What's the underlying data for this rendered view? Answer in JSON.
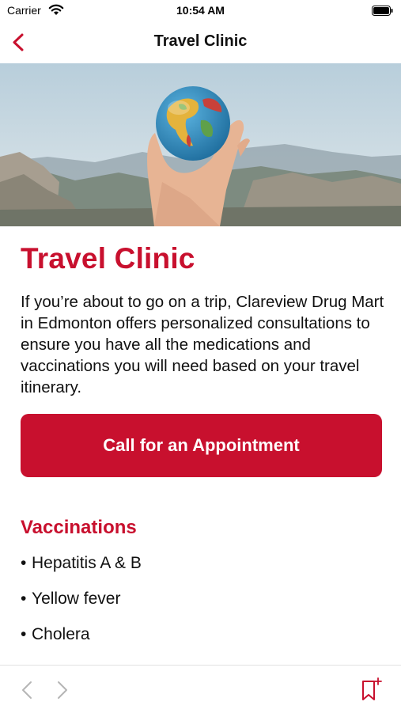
{
  "status_bar": {
    "carrier": "Carrier",
    "time": "10:54 AM"
  },
  "nav": {
    "title": "Travel Clinic",
    "back_icon": "chevron-left-icon"
  },
  "content": {
    "heading": "Travel Clinic",
    "intro": "If you’re about to go on a trip, Clareview Drug Mart in Edmonton offers personalized consultations to ensure you have all the medications and vaccinations you will need based on your travel itinerary.",
    "cta_label": "Call for an Appointment",
    "vaccinations_heading": "Vaccinations",
    "vaccinations": [
      "Hepatitis A & B",
      "Yellow fever",
      "Cholera"
    ]
  },
  "bottom_bar": {
    "prev_icon": "chevron-left-icon",
    "next_icon": "chevron-right-icon",
    "bookmark_icon": "bookmark-add-icon"
  },
  "colors": {
    "accent": "#c8102e",
    "text": "#111111",
    "disabled_icon": "#b5b5b5"
  }
}
